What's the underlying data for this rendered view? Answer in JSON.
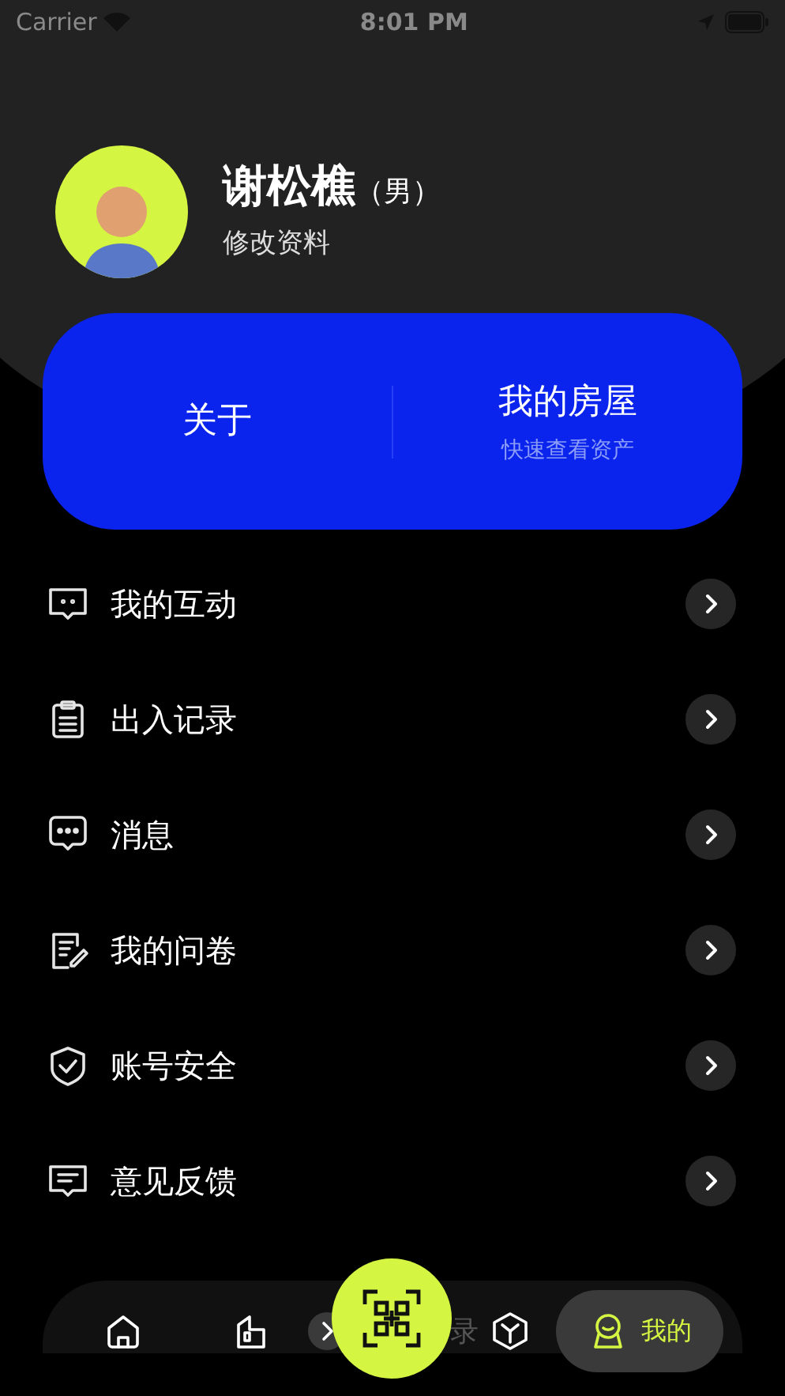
{
  "status_bar": {
    "carrier": "Carrier",
    "time": "8:01 PM"
  },
  "profile": {
    "name": "谢松樵",
    "gender": "（男）",
    "edit_link": "修改资料"
  },
  "card": {
    "about": "关于",
    "house_title": "我的房屋",
    "house_subtitle": "快速查看资产"
  },
  "menu": [
    {
      "kind": "interaction",
      "label": "我的互动"
    },
    {
      "kind": "records",
      "label": "出入记录"
    },
    {
      "kind": "message",
      "label": "消息"
    },
    {
      "kind": "survey",
      "label": "我的问卷"
    },
    {
      "kind": "security",
      "label": "账号安全"
    },
    {
      "kind": "feedback",
      "label": "意见反馈"
    }
  ],
  "tab_bar": {
    "tabs": [
      {
        "kind": "home",
        "selected": false
      },
      {
        "kind": "building",
        "selected": false
      },
      {
        "kind": "records",
        "label": "录",
        "selected": false
      },
      {
        "kind": "cube",
        "selected": false
      },
      {
        "kind": "user",
        "label": "我的",
        "selected": true
      }
    ]
  }
}
